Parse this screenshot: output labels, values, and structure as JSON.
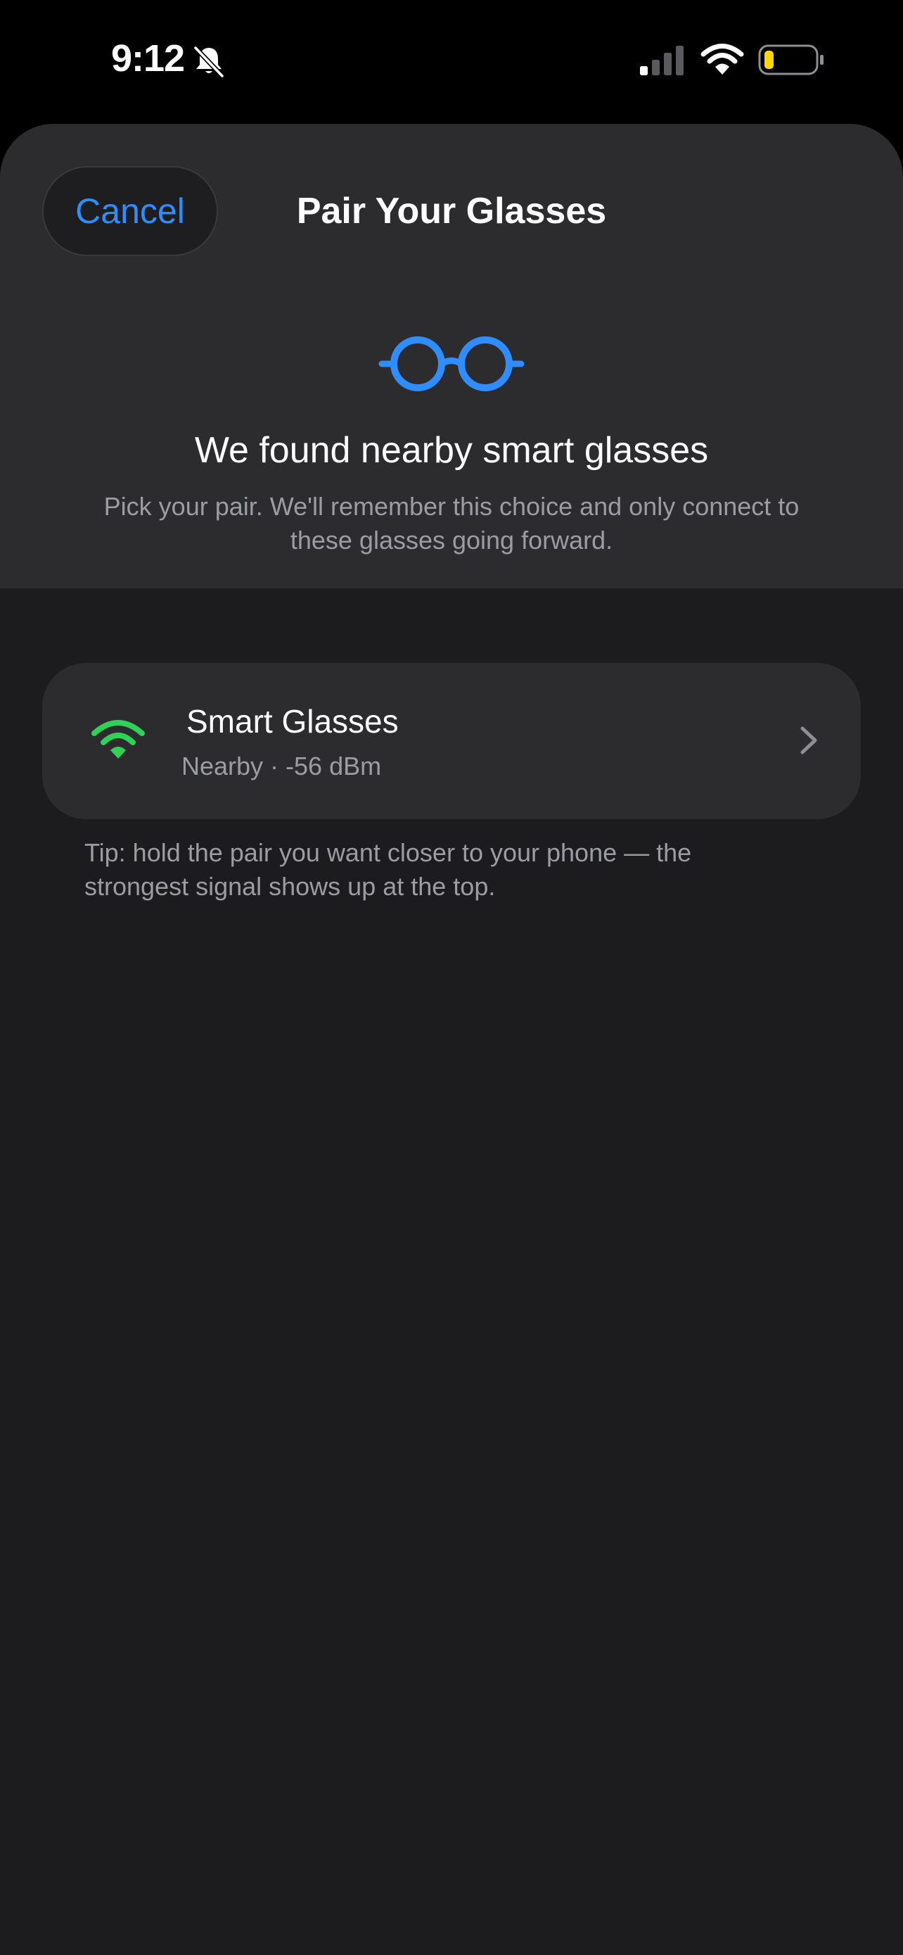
{
  "status_bar": {
    "time": "9:12",
    "icons": [
      "bell-slash-icon",
      "cellular-signal-icon",
      "wifi-icon",
      "battery-low-icon"
    ]
  },
  "sheet": {
    "cancel_label": "Cancel",
    "title": "Pair Your Glasses",
    "hero_icon": "glasses-icon",
    "found_title": "We found nearby smart glasses",
    "found_subtitle": "Pick your pair. We'll remember this choice and only connect to these glasses going forward."
  },
  "devices": [
    {
      "name": "Smart Glasses",
      "status": "Nearby · -56 dBm",
      "icon": "wifi-signal-icon"
    }
  ],
  "tip": "Tip: hold the pair you want closer to your phone — the strongest signal shows up at the top.",
  "colors": {
    "accent_blue": "#2f8dff",
    "signal_green": "#30d158",
    "battery_yellow": "#ffd60a",
    "background": "#1c1c1e",
    "card": "#2c2c2e",
    "secondary_text": "#9c9ca3"
  }
}
